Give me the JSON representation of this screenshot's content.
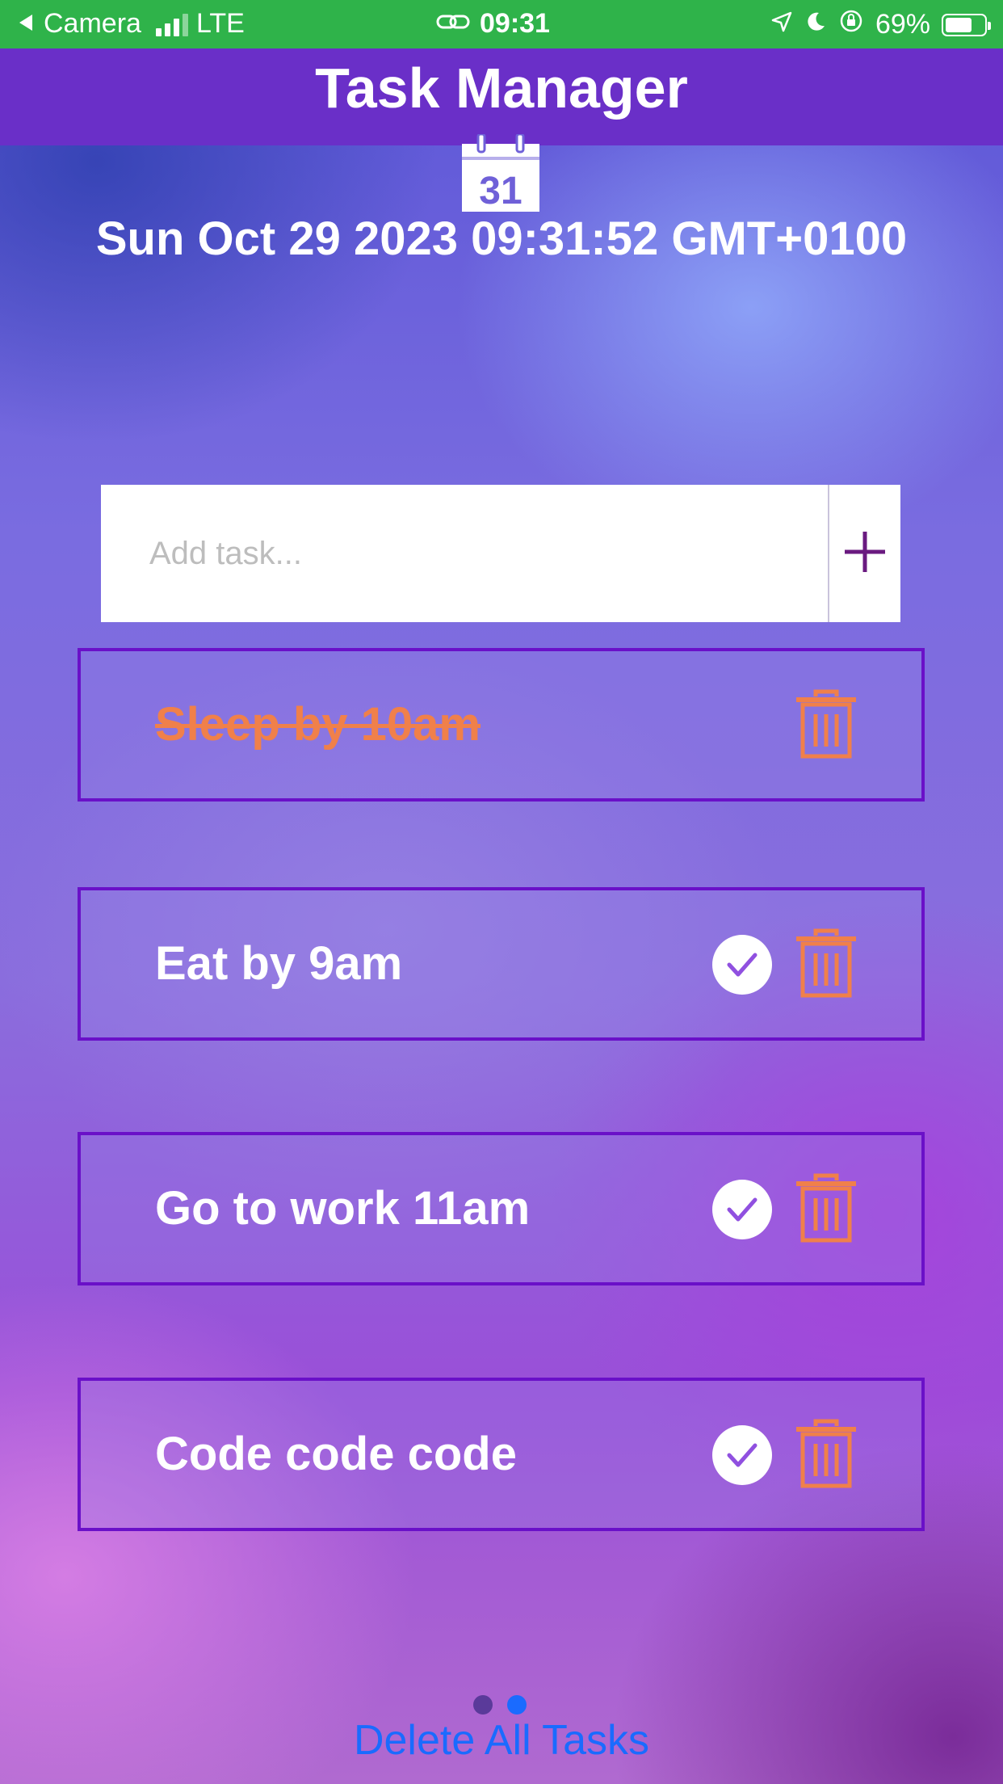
{
  "status_bar": {
    "back_app": "Camera",
    "network": "LTE",
    "time": "09:31",
    "battery": "69%",
    "battery_level": 0.69,
    "colors": {
      "background": "#2fb34a"
    }
  },
  "header": {
    "title": "Task Manager",
    "calendar_day": "31",
    "date_time": "Sun Oct 29 2023 09:31:52 GMT+0100"
  },
  "add_task": {
    "value": "",
    "placeholder": "Add task...",
    "add_icon": "plus-icon"
  },
  "tasks": [
    {
      "label": "Sleep by 10am",
      "completed": true
    },
    {
      "label": "Eat by 9am",
      "completed": false
    },
    {
      "label": "Go to work 11am",
      "completed": false
    },
    {
      "label": "Code code code",
      "completed": false
    }
  ],
  "icons": {
    "complete": "check-circle-icon",
    "delete": "trash-icon",
    "calendar": "calendar-icon"
  },
  "pager": {
    "total": 2,
    "current": 2
  },
  "footer": {
    "delete_all_label": "Delete All Tasks"
  },
  "colors": {
    "header": "#6a2fc8",
    "task_border": "#6a10c8",
    "accent_orange": "#f0804a",
    "check_purple": "#9050e0",
    "link_blue": "#1a6bff"
  }
}
